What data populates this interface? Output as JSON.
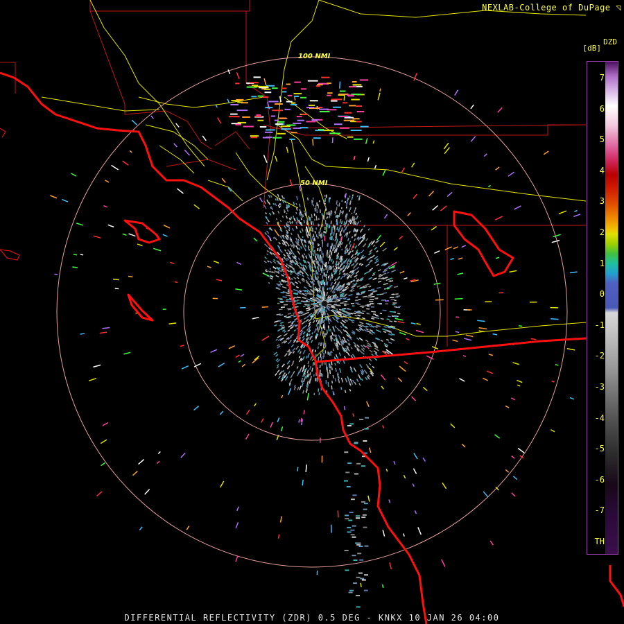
{
  "credit": "NEXLAB-College of DuPage",
  "footer": "DIFFERENTIAL REFLECTIVITY (ZDR) 0.5 DEG - KNKX 10 JAN 26 04:00",
  "colorbar": {
    "title": "DZD",
    "units": "[dB]",
    "ticks": [
      "7",
      "6",
      "5",
      "4",
      "3",
      "2",
      "1",
      "0",
      "-1",
      "-2",
      "-3",
      "-4",
      "-5",
      "-6",
      "-7",
      "TH"
    ]
  },
  "range_rings": [
    "100 NMI",
    "50 NMI"
  ],
  "colors": {
    "coastline": "#ff1010",
    "boundary": "#cc1c1c",
    "highway": "#e6e600",
    "ring": "#e8a0a0",
    "label": "#ffff4d"
  },
  "icons": [
    "logo-icon"
  ]
}
